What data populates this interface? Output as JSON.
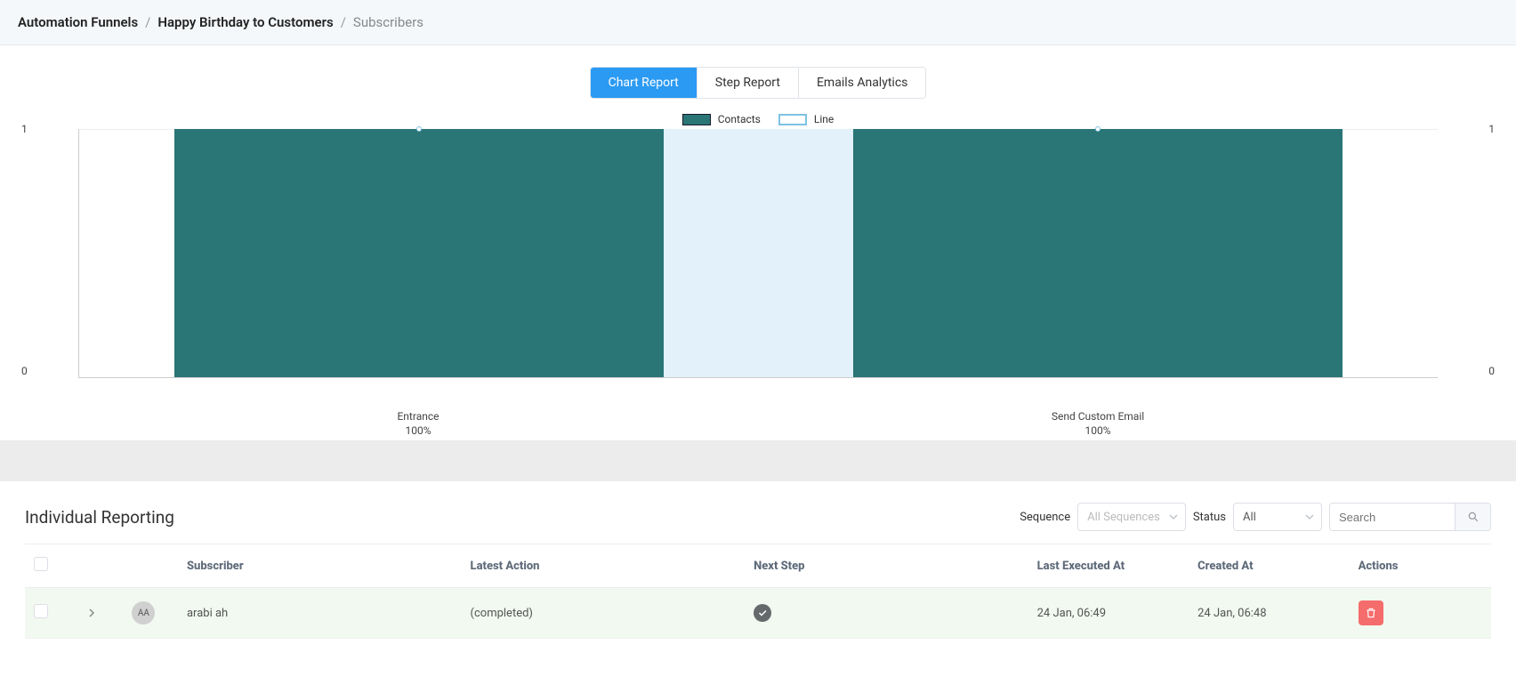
{
  "breadcrumb": {
    "root": "Automation Funnels",
    "funnel": "Happy Birthday to Customers",
    "current": "Subscribers"
  },
  "tabs": {
    "chart_report": "Chart Report",
    "step_report": "Step Report",
    "emails_analytics": "Emails Analytics"
  },
  "legend": {
    "contacts": "Contacts",
    "line": "Line"
  },
  "chart_data": {
    "type": "bar",
    "categories": [
      "Entrance",
      "Send Custom Email"
    ],
    "series": [
      {
        "name": "Contacts",
        "values": [
          1,
          1
        ]
      },
      {
        "name": "Line",
        "values": [
          1,
          1
        ]
      }
    ],
    "percentages": [
      "100%",
      "100%"
    ],
    "ylim": [
      0,
      1
    ],
    "y_ticks": [
      0,
      1
    ],
    "ylabel": "",
    "xlabel": ""
  },
  "report": {
    "title": "Individual Reporting",
    "filters": {
      "sequence_label": "Sequence",
      "sequence_placeholder": "All Sequences",
      "status_label": "Status",
      "status_value": "All",
      "search_placeholder": "Search"
    },
    "columns": {
      "subscriber": "Subscriber",
      "latest_action": "Latest Action",
      "next_step": "Next Step",
      "last_executed": "Last Executed At",
      "created": "Created At",
      "actions": "Actions"
    },
    "rows": [
      {
        "avatar_initials": "AA",
        "subscriber": "arabi ah",
        "latest_action": "(completed)",
        "next_step_done": true,
        "last_executed": "24 Jan, 06:49",
        "created": "24 Jan, 06:48"
      }
    ]
  }
}
